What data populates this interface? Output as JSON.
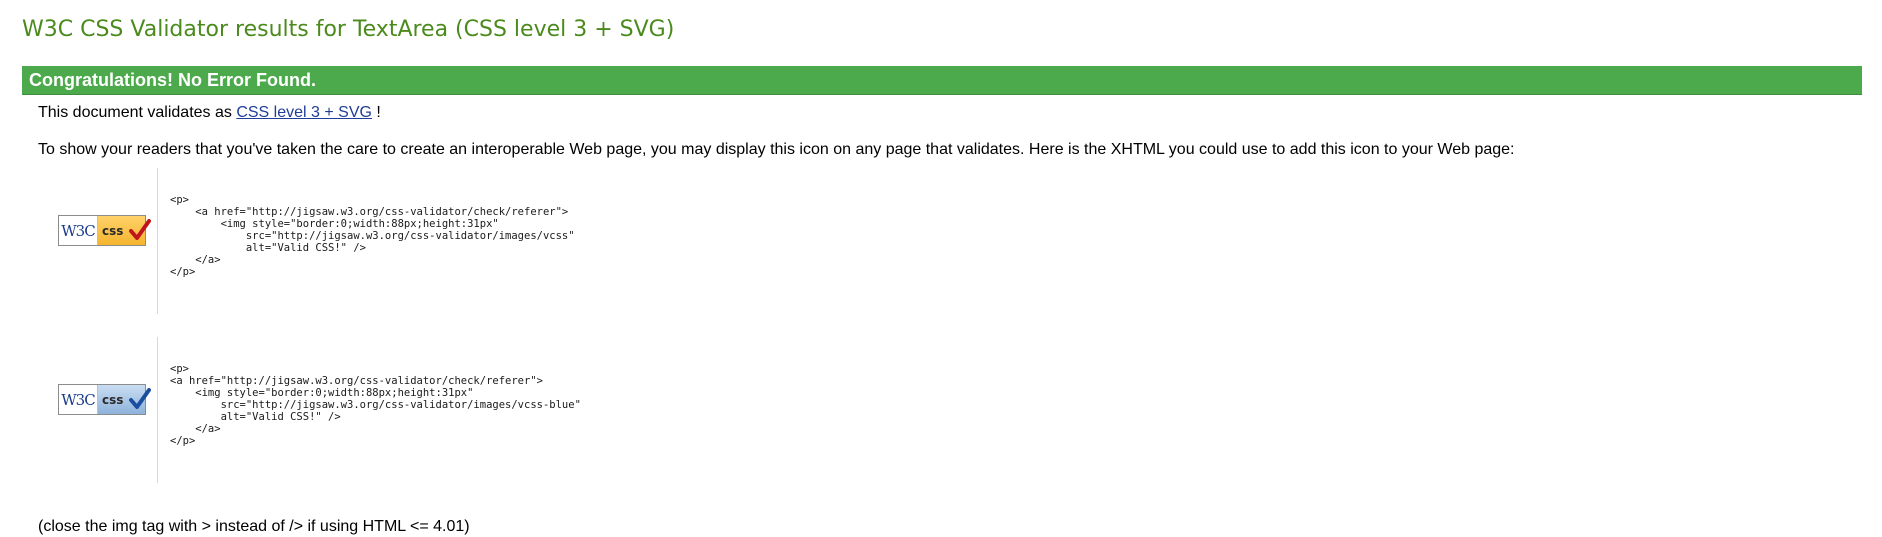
{
  "page": {
    "title": "W3C CSS Validator results for TextArea (CSS level 3 + SVG)"
  },
  "banner": {
    "text": "Congratulations! No Error Found."
  },
  "validates": {
    "prefix": "This document validates as ",
    "link_text": "CSS level 3 + SVG",
    "suffix": " !"
  },
  "show_icon_text": "To show your readers that you've taken the care to create an interoperable Web page, you may display this icon on any page that validates. Here is the XHTML you could use to add this icon to your Web page:",
  "badges": [
    {
      "w3c_text": "W3C",
      "css_text": "css",
      "style": "gold",
      "check_color": "#c0151b",
      "code": "<p>\n    <a href=\"http://jigsaw.w3.org/css-validator/check/referer\">\n        <img style=\"border:0;width:88px;height:31px\"\n            src=\"http://jigsaw.w3.org/css-validator/images/vcss\"\n            alt=\"Valid CSS!\" />\n    </a>\n</p>"
    },
    {
      "w3c_text": "W3C",
      "css_text": "css",
      "style": "blue",
      "check_color": "#1a4fa0",
      "code": "<p>\n<a href=\"http://jigsaw.w3.org/css-validator/check/referer\">\n    <img style=\"border:0;width:88px;height:31px\"\n        src=\"http://jigsaw.w3.org/css-validator/images/vcss-blue\"\n        alt=\"Valid CSS!\" />\n    </a>\n</p>"
    }
  ],
  "close_note": "(close the img tag with > instead of /> if using HTML <= 4.01)",
  "colors": {
    "title": "#4b8a1c",
    "banner": "#4caa4c",
    "link": "#1f3d99"
  }
}
